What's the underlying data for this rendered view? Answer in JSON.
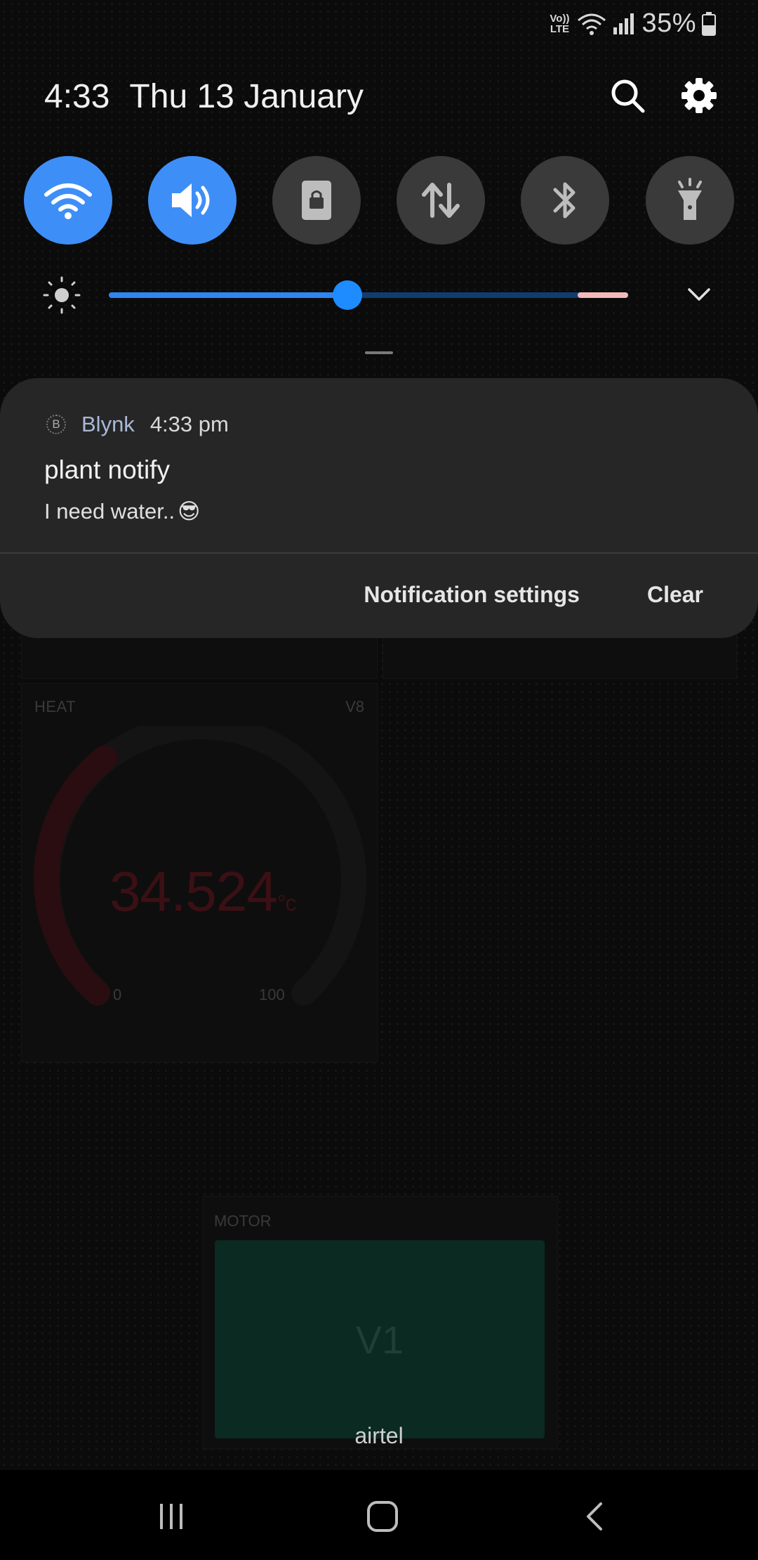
{
  "status_bar": {
    "network_label": "Vo)) LTE",
    "battery": "35%"
  },
  "quick_panel": {
    "time": "4:33",
    "date": "Thu 13 January",
    "toggles": [
      {
        "name": "wifi",
        "state": "on"
      },
      {
        "name": "sound",
        "state": "on"
      },
      {
        "name": "screen-lock",
        "state": "off"
      },
      {
        "name": "mobile-data",
        "state": "off"
      },
      {
        "name": "bluetooth",
        "state": "off"
      },
      {
        "name": "flashlight",
        "state": "off"
      }
    ],
    "brightness_level": 0.46
  },
  "notification": {
    "app_name": "Blynk",
    "time": "4:33 pm",
    "title": "plant notify",
    "body": "I need water..",
    "emoji": "😎",
    "settings_label": "Notification settings",
    "clear_label": "Clear"
  },
  "background_app": {
    "heat_widget": {
      "label": "HEAT",
      "pin": "V8",
      "value": "34.524",
      "unit": "°c",
      "min": "0",
      "max": "100"
    },
    "motor_widget": {
      "label": "MOTOR",
      "button_text": "V1"
    },
    "carrier": "airtel"
  },
  "colors": {
    "accent": "#3e8ef7",
    "card": "#262626",
    "toggle_off": "#3a3a3a"
  }
}
